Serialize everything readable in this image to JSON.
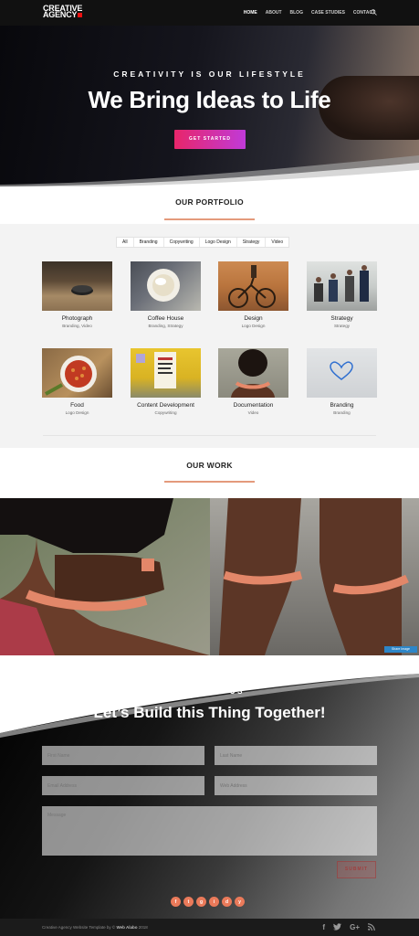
{
  "nav": {
    "logo_line1": "CREATIVE",
    "logo_line2": "AGENCY",
    "items": [
      "HOME",
      "ABOUT",
      "BLOG",
      "CASE STUDIES",
      "CONTACT"
    ],
    "active": "HOME",
    "search_icon": "search-icon"
  },
  "hero": {
    "subtitle": "CREATIVITY IS OUR LIFESTYLE",
    "title": "We Bring Ideas to Life",
    "cta": "GET STARTED"
  },
  "portfolio": {
    "heading": "OUR PORTFOLIO",
    "filters": [
      "All",
      "Branding",
      "Copywriting",
      "Logo Design",
      "Strategy",
      "Video"
    ],
    "items": [
      {
        "title": "Photograph",
        "category": "Branding, Video"
      },
      {
        "title": "Coffee House",
        "category": "Branding, Strategy"
      },
      {
        "title": "Design",
        "category": "Logo Design"
      },
      {
        "title": "Strategy",
        "category": "Strategy"
      },
      {
        "title": "Food",
        "category": "Logo Design"
      },
      {
        "title": "Content Development",
        "category": "Copywriting"
      },
      {
        "title": "Documentation",
        "category": "Video"
      },
      {
        "title": "Branding",
        "category": "Branding"
      }
    ]
  },
  "work": {
    "heading": "OUR WORK",
    "share_label": "Share Image"
  },
  "contact": {
    "subtitle": "CONTACT US",
    "title": "Let’s Build this Thing Together!",
    "first_name": "First Name",
    "last_name": "Last Name",
    "email": "Email Address",
    "website": "Web Address",
    "message": "Message",
    "submit": "SUBMIT",
    "social": [
      "f",
      "t",
      "g",
      "i",
      "d",
      "y"
    ]
  },
  "footer": {
    "text_prefix": "Creative Agency Website Template by © ",
    "brand": "Web Alabo",
    "year": " 2018",
    "icons": [
      "f",
      "t",
      "G+",
      "rss"
    ]
  },
  "colors": {
    "accent_line": "#e49a7c",
    "cta_start": "#e8266a",
    "cta_end": "#c03ad8",
    "social": "#ea7a5a"
  }
}
